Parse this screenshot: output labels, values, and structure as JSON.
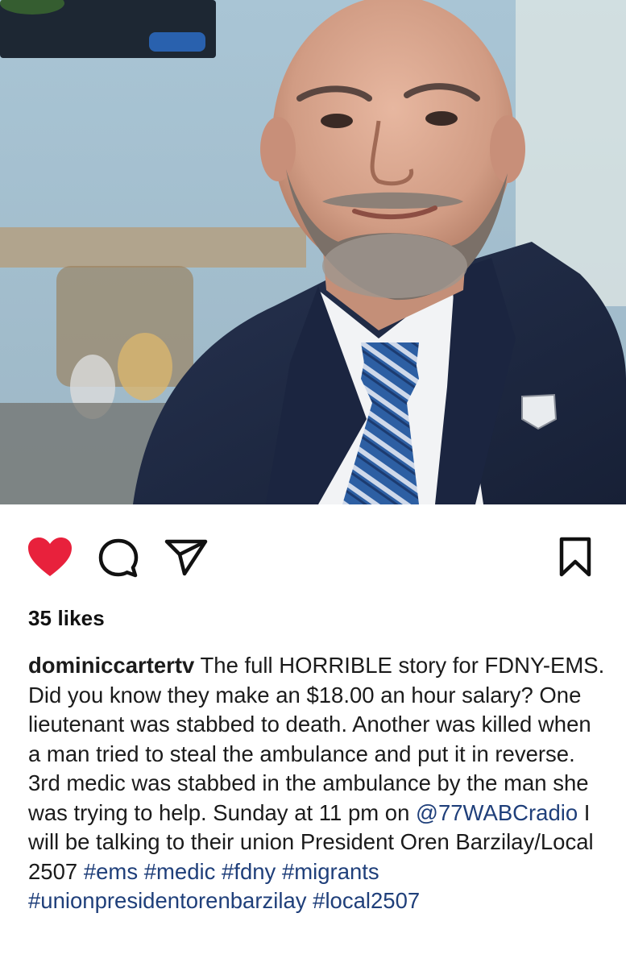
{
  "post": {
    "image_alt": "Portrait of a bald man with a grey beard wearing a navy suit, white shirt and blue striped tie",
    "likes_text": "35 likes",
    "caption": {
      "username": "dominiccartertv",
      "text_1": " The full HORRIBLE story for FDNY-EMS. Did you know they make an $18.00 an hour salary? One lieutenant was stabbed to death. Another was killed when a man tried to steal the ambulance and put it in reverse. 3rd medic was stabbed in the ambulance by the man she was trying to help. Sunday at 11 pm on ",
      "mention": "@77WABCradio",
      "text_2": " I will be talking to their union President Oren Barzilay/Local 2507 ",
      "hashtags": [
        "#ems",
        "#medic",
        "#fdny",
        "#migrants",
        "#unionpresidentorenbarzilay",
        "#local2507"
      ]
    },
    "icons": {
      "like": "heart-icon",
      "comment": "comment-bubble-icon",
      "share": "paper-plane-icon",
      "save": "bookmark-icon"
    },
    "colors": {
      "like_active": "#e8213c",
      "link": "#1f3f7a",
      "suit": "#1e2a44",
      "tie": "#2f5d9e"
    }
  }
}
